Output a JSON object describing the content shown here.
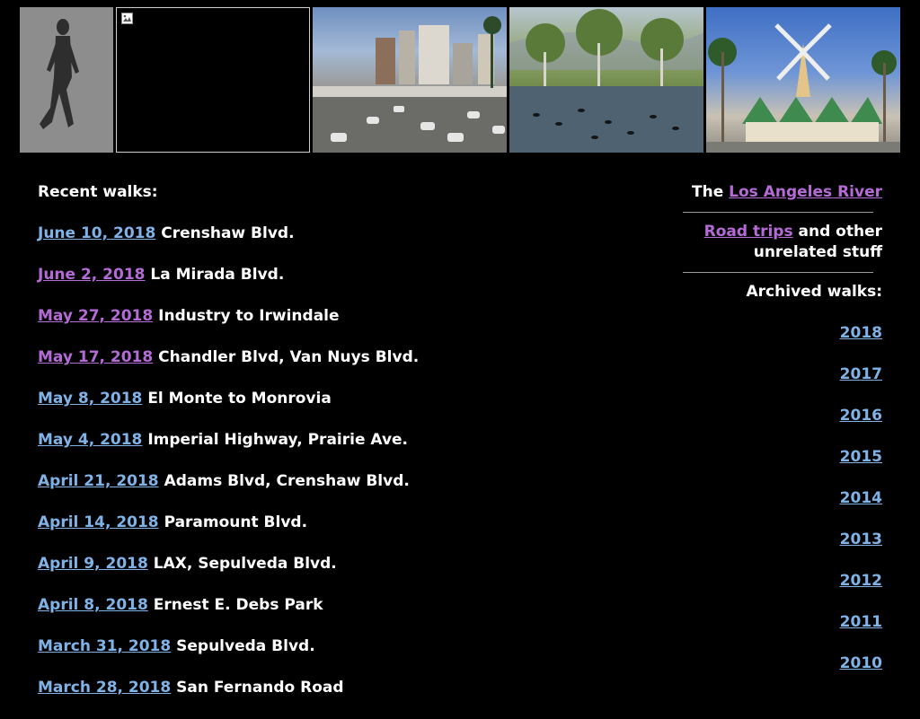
{
  "banner": {
    "images": [
      {
        "name": "walker-silhouette"
      },
      {
        "name": "broken-image-icon"
      },
      {
        "name": "freeway-photo"
      },
      {
        "name": "park-lake-photo"
      },
      {
        "name": "windmill-photo"
      }
    ]
  },
  "recent": {
    "heading": "Recent walks:",
    "walks": [
      {
        "date": "June 10, 2018",
        "title": "Crenshaw Blvd.",
        "visited": false
      },
      {
        "date": "June 2, 2018",
        "title": "La Mirada Blvd.",
        "visited": true
      },
      {
        "date": "May 27, 2018",
        "title": "Industry to Irwindale",
        "visited": true
      },
      {
        "date": "May 17, 2018",
        "title": "Chandler Blvd, Van Nuys Blvd.",
        "visited": true
      },
      {
        "date": "May 8, 2018",
        "title": "El Monte to Monrovia",
        "visited": false
      },
      {
        "date": "May 4, 2018",
        "title": "Imperial Highway, Prairie Ave.",
        "visited": false
      },
      {
        "date": "April 21, 2018",
        "title": "Adams Blvd, Crenshaw Blvd.",
        "visited": false
      },
      {
        "date": "April 14, 2018",
        "title": "Paramount Blvd.",
        "visited": false
      },
      {
        "date": "April 9, 2018",
        "title": "LAX, Sepulveda Blvd.",
        "visited": false
      },
      {
        "date": "April 8, 2018",
        "title": "Ernest E. Debs Park",
        "visited": false
      },
      {
        "date": "March 31, 2018",
        "title": "Sepulveda Blvd.",
        "visited": false
      },
      {
        "date": "March 28, 2018",
        "title": "San Fernando Road",
        "visited": false
      }
    ]
  },
  "sidebar": {
    "river_prefix": "The",
    "river_link": "Los Angeles River",
    "roadtrips_link": "Road trips",
    "roadtrips_suffix": "and other unrelated stuff",
    "archived_heading": "Archived walks:",
    "years": [
      "2018",
      "2017",
      "2016",
      "2015",
      "2014",
      "2013",
      "2012",
      "2011",
      "2010"
    ]
  },
  "colors": {
    "background": "#000000",
    "text": "#ffffff",
    "link": "#7fb3e8",
    "visited_link": "#b56bd6"
  }
}
